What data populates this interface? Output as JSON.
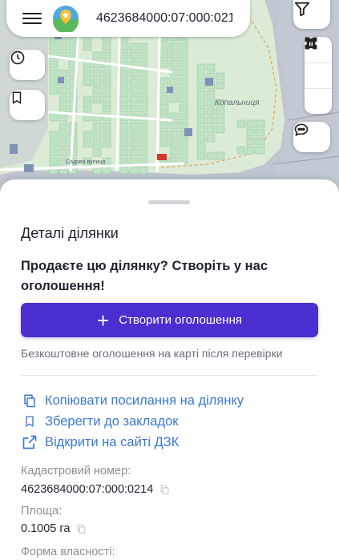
{
  "search": {
    "value": "4623684000:07:000:0214",
    "placeholder": ""
  },
  "map": {
    "district_label": "Копальниця",
    "street_label": "Садова вулиця",
    "colors": {
      "water": "#bfc6d0",
      "land": "#dcebd6",
      "parcel": "#bde3c4",
      "parcel_highlight": "#d9362b",
      "parcel_blue": "#7e92b8"
    }
  },
  "icons": {
    "menu": "hamburger-menu-icon",
    "logo": "map-pin-logo-icon",
    "filter": "filter-icon",
    "history": "clock-icon",
    "bookmark": "bookmark-icon",
    "measure": "ruler-line-icon",
    "area": "polygon-area-icon",
    "delete": "trash-icon",
    "chat": "chat-bubble-icon"
  },
  "sheet": {
    "title": "Деталі ділянки",
    "promo_title": "Продаєте цю ділянку? Створіть у нас оголошення!",
    "create_button": "Створити оголошення",
    "free_note": "Безкоштовне оголошення на карті після перевірки",
    "actions": {
      "copy": "Копіювати посилання на ділянку",
      "save": "Зберегти до закладок",
      "open": "Відкрити на сайті ДЗК"
    },
    "fields": {
      "cadastral_label": "Кадастровий номер:",
      "cadastral_value": "4623684000:07:000:0214",
      "area_label": "Площа:",
      "area_value": "0.1005 га",
      "ownership_label": "Форма власності:"
    }
  },
  "accent": "#4b2fd1",
  "link_color": "#3a78d4"
}
